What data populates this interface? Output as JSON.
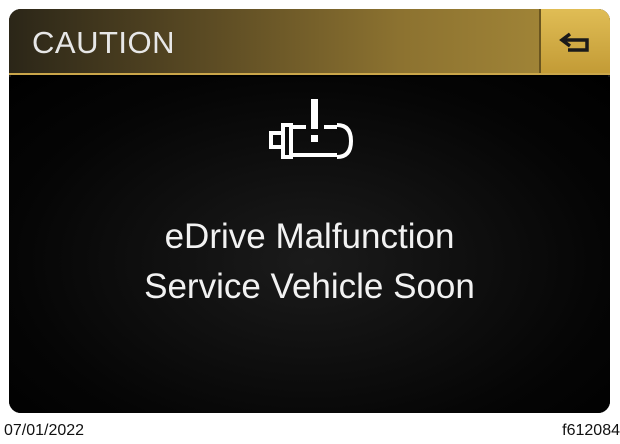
{
  "header": {
    "title": "CAUTION"
  },
  "back": {
    "icon": "back-arrow-icon"
  },
  "warning": {
    "icon": "edrive-malfunction-icon"
  },
  "message": {
    "line1": "eDrive Malfunction",
    "line2": "Service Vehicle Soon"
  },
  "footer": {
    "date": "07/01/2022",
    "figure_id": "f612084"
  },
  "colors": {
    "header_gold": "#a98c3a",
    "button_gold": "#d4b04a",
    "text": "#f2f2f2"
  }
}
